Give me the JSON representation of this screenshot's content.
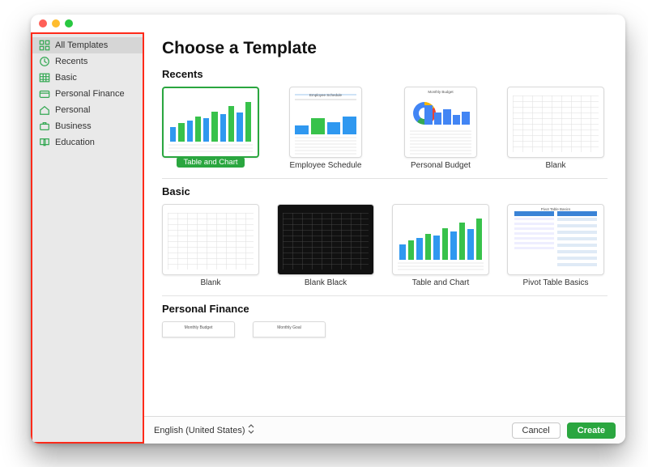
{
  "header": {
    "title": "Choose a Template"
  },
  "sidebar": {
    "items": [
      {
        "label": "All Templates",
        "icon": "grid-icon",
        "selected": true
      },
      {
        "label": "Recents",
        "icon": "clock-icon",
        "selected": false
      },
      {
        "label": "Basic",
        "icon": "table-icon",
        "selected": false
      },
      {
        "label": "Personal Finance",
        "icon": "wallet-icon",
        "selected": false
      },
      {
        "label": "Personal",
        "icon": "home-icon",
        "selected": false
      },
      {
        "label": "Business",
        "icon": "briefcase-icon",
        "selected": false
      },
      {
        "label": "Education",
        "icon": "book-icon",
        "selected": false
      }
    ]
  },
  "sections": {
    "recents": {
      "title": "Recents",
      "templates": [
        {
          "label": "Table and Chart",
          "selected": true,
          "kind": "barchart"
        },
        {
          "label": "Employee Schedule",
          "selected": false,
          "kind": "schedule",
          "thumb_title": "Employee Schedule"
        },
        {
          "label": "Personal Budget",
          "selected": false,
          "kind": "budget",
          "thumb_title": "Monthly Budget"
        },
        {
          "label": "Blank",
          "selected": false,
          "kind": "blank"
        }
      ]
    },
    "basic": {
      "title": "Basic",
      "templates": [
        {
          "label": "Blank",
          "kind": "blank"
        },
        {
          "label": "Blank Black",
          "kind": "blank-black"
        },
        {
          "label": "Table and Chart",
          "kind": "barchart"
        },
        {
          "label": "Pivot Table Basics",
          "kind": "pivot",
          "thumb_title": "Pivot Table Basics"
        }
      ]
    },
    "personal_finance": {
      "title": "Personal Finance",
      "peek": [
        {
          "thumb_title": "Monthly Budget"
        },
        {
          "thumb_title": "Monthly Goal"
        }
      ]
    }
  },
  "footer": {
    "language": "English (United States)",
    "cancel": "Cancel",
    "create": "Create"
  }
}
